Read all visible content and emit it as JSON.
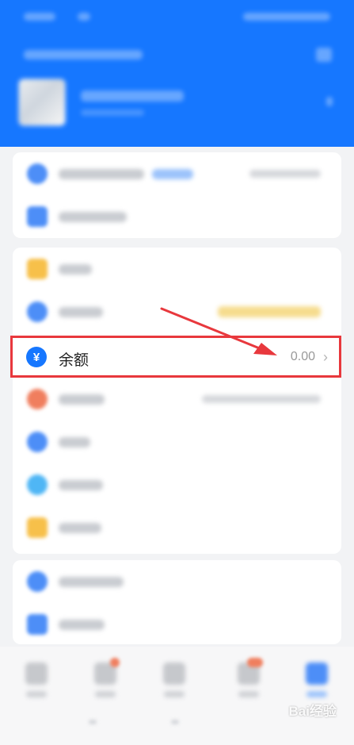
{
  "balance_row": {
    "icon_glyph": "¥",
    "label": "余额",
    "amount": "0.00",
    "chevron": "›"
  },
  "watermark": {
    "text": "Bai经验"
  },
  "colors": {
    "header_blue": "#1677ff",
    "highlight_red": "#e8383d",
    "arrow_red": "#e8383d"
  }
}
